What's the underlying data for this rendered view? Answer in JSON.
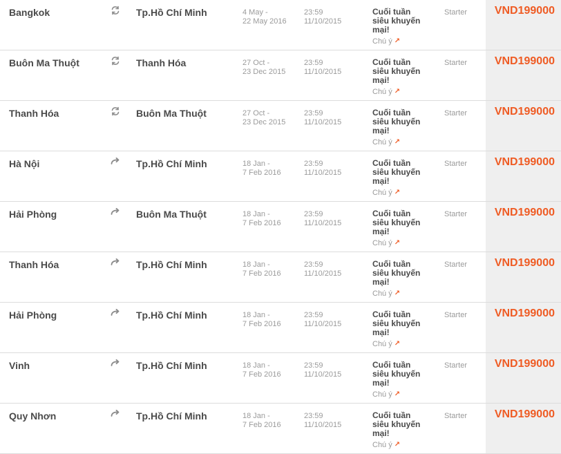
{
  "accent_color": "#ef5b23",
  "rows": [
    {
      "origin": "Bangkok",
      "trip_icon": "round-trip-icon",
      "destination": "Tp.Hồ Chí Minh",
      "travel_start": "4 May -",
      "travel_end": "22 May 2016",
      "deadline_time": "23:59",
      "deadline_date": "11/10/2015",
      "promo_line1": "Cuối tuần",
      "promo_line2": "siêu khuyến",
      "promo_line3": "mại!",
      "note": "Chú ý",
      "fare_class": "Starter",
      "price": "VND199000"
    },
    {
      "origin": "Buôn Ma Thuột",
      "trip_icon": "round-trip-icon",
      "destination": "Thanh Hóa",
      "travel_start": "27 Oct -",
      "travel_end": "23 Dec 2015",
      "deadline_time": "23:59",
      "deadline_date": "11/10/2015",
      "promo_line1": "Cuối tuần",
      "promo_line2": "siêu khuyến",
      "promo_line3": "mại!",
      "note": "Chú ý",
      "fare_class": "Starter",
      "price": "VND199000"
    },
    {
      "origin": "Thanh Hóa",
      "trip_icon": "round-trip-icon",
      "destination": "Buôn Ma Thuột",
      "travel_start": "27 Oct -",
      "travel_end": "23 Dec 2015",
      "deadline_time": "23:59",
      "deadline_date": "11/10/2015",
      "promo_line1": "Cuối tuần",
      "promo_line2": "siêu khuyến",
      "promo_line3": "mại!",
      "note": "Chú ý",
      "fare_class": "Starter",
      "price": "VND199000"
    },
    {
      "origin": "Hà Nội",
      "trip_icon": "one-way-icon",
      "destination": "Tp.Hồ Chí Minh",
      "travel_start": "18 Jan -",
      "travel_end": "7 Feb 2016",
      "deadline_time": "23:59",
      "deadline_date": "11/10/2015",
      "promo_line1": "Cuối tuần",
      "promo_line2": "siêu khuyến",
      "promo_line3": "mại!",
      "note": "Chú ý",
      "fare_class": "Starter",
      "price": "VND199000"
    },
    {
      "origin": "Hải Phòng",
      "trip_icon": "one-way-icon",
      "destination": "Buôn Ma Thuột",
      "travel_start": "18 Jan -",
      "travel_end": "7 Feb 2016",
      "deadline_time": "23:59",
      "deadline_date": "11/10/2015",
      "promo_line1": "Cuối tuần",
      "promo_line2": "siêu khuyến",
      "promo_line3": "mại!",
      "note": "Chú ý",
      "fare_class": "Starter",
      "price": "VND199000"
    },
    {
      "origin": "Thanh Hóa",
      "trip_icon": "one-way-icon",
      "destination": "Tp.Hồ Chí Minh",
      "travel_start": "18 Jan -",
      "travel_end": "7 Feb 2016",
      "deadline_time": "23:59",
      "deadline_date": "11/10/2015",
      "promo_line1": "Cuối tuần",
      "promo_line2": "siêu khuyến",
      "promo_line3": "mại!",
      "note": "Chú ý",
      "fare_class": "Starter",
      "price": "VND199000"
    },
    {
      "origin": "Hải Phòng",
      "trip_icon": "one-way-icon",
      "destination": "Tp.Hồ Chí Minh",
      "travel_start": "18 Jan -",
      "travel_end": "7 Feb 2016",
      "deadline_time": "23:59",
      "deadline_date": "11/10/2015",
      "promo_line1": "Cuối tuần",
      "promo_line2": "siêu khuyến",
      "promo_line3": "mại!",
      "note": "Chú ý",
      "fare_class": "Starter",
      "price": "VND199000"
    },
    {
      "origin": "Vinh",
      "trip_icon": "one-way-icon",
      "destination": "Tp.Hồ Chí Minh",
      "travel_start": "18 Jan -",
      "travel_end": "7 Feb 2016",
      "deadline_time": "23:59",
      "deadline_date": "11/10/2015",
      "promo_line1": "Cuối tuần",
      "promo_line2": "siêu khuyến",
      "promo_line3": "mại!",
      "note": "Chú ý",
      "fare_class": "Starter",
      "price": "VND199000"
    },
    {
      "origin": "Quy Nhơn",
      "trip_icon": "one-way-icon",
      "destination": "Tp.Hồ Chí Minh",
      "travel_start": "18 Jan -",
      "travel_end": "7 Feb 2016",
      "deadline_time": "23:59",
      "deadline_date": "11/10/2015",
      "promo_line1": "Cuối tuần",
      "promo_line2": "siêu khuyến",
      "promo_line3": "mại!",
      "note": "Chú ý",
      "fare_class": "Starter",
      "price": "VND199000"
    }
  ]
}
